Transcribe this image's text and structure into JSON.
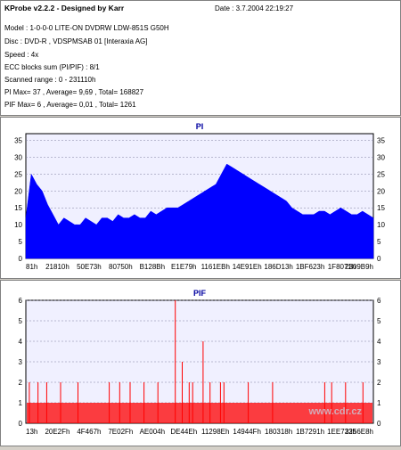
{
  "info": {
    "title": "KProbe v2.2.2 - Designed by Karr",
    "date": "Date : 3.7.2004 22:19:27",
    "model": "Model : 1-0-0-0 LITE-ON DVDRW LDW-851S   G50H",
    "disc": "Disc : DVD-R , VDSPMSAB 01 [Interaxia AG]",
    "speed": "Speed : 4x",
    "ecc": "ECC blocks sum (PI/PIF) : 8/1",
    "range": "Scanned range : 0 - 231110h",
    "pi_stats": "PI Max= 37 , Average= 9,69 , Total= 168827",
    "pif_stats": "PIF Max= 6 , Average= 0,01 , Total= 1261"
  },
  "watermark": "www.cdr.cz",
  "colors": {
    "pi": "#0000ff",
    "pif": "#ff0000",
    "title": "#0000a0",
    "plot_bg": "#f0f0ff"
  },
  "chart_data": [
    {
      "type": "area",
      "title": "PI",
      "ylim": [
        0,
        37
      ],
      "yticks": [
        0,
        5,
        10,
        15,
        20,
        25,
        30,
        35
      ],
      "xtick_labels": [
        "81h",
        "21810h",
        "50E73h",
        "80750h",
        "B128Bh",
        "E1E79h",
        "1161EBh",
        "14E91Eh",
        "186D13h",
        "1BF623h",
        "1F8071h",
        "2309B9h"
      ],
      "grid": true,
      "series": [
        {
          "values": [
            12,
            25,
            22,
            20,
            16,
            13,
            10,
            12,
            11,
            10,
            10,
            12,
            11,
            10,
            12,
            12,
            11,
            13,
            12,
            12,
            13,
            12,
            12,
            14,
            13,
            14,
            15,
            15,
            15,
            16,
            17,
            18,
            19,
            20,
            21,
            22,
            25,
            28,
            27,
            26,
            25,
            24,
            23,
            22,
            21,
            20,
            19,
            18,
            17,
            15,
            14,
            13,
            13,
            13,
            14,
            14,
            13,
            14,
            15,
            14,
            13,
            13,
            14,
            13,
            12
          ]
        }
      ]
    },
    {
      "type": "bar",
      "title": "PIF",
      "ylim": [
        0,
        6
      ],
      "yticks": [
        0,
        1,
        2,
        3,
        4,
        5,
        6
      ],
      "xtick_labels": [
        "13h",
        "20E2Fh",
        "4F467h",
        "7E02Fh",
        "AE004h",
        "DE44Eh",
        "11298Eh",
        "14944Fh",
        "180318h",
        "1B7291h",
        "1EE733h",
        "2256E8h"
      ],
      "grid": true,
      "series": [
        {
          "points": [
            [
              0.01,
              2
            ],
            [
              0.035,
              2
            ],
            [
              0.06,
              2
            ],
            [
              0.1,
              2
            ],
            [
              0.15,
              2
            ],
            [
              0.24,
              2
            ],
            [
              0.27,
              2
            ],
            [
              0.3,
              2
            ],
            [
              0.34,
              2
            ],
            [
              0.38,
              2
            ],
            [
              0.43,
              6
            ],
            [
              0.45,
              3
            ],
            [
              0.47,
              2
            ],
            [
              0.48,
              2
            ],
            [
              0.51,
              4
            ],
            [
              0.53,
              2
            ],
            [
              0.56,
              2
            ],
            [
              0.57,
              2
            ],
            [
              0.64,
              2
            ],
            [
              0.71,
              2
            ],
            [
              0.86,
              2
            ],
            [
              0.88,
              2
            ],
            [
              0.92,
              2
            ],
            [
              0.97,
              2
            ]
          ]
        }
      ]
    }
  ]
}
